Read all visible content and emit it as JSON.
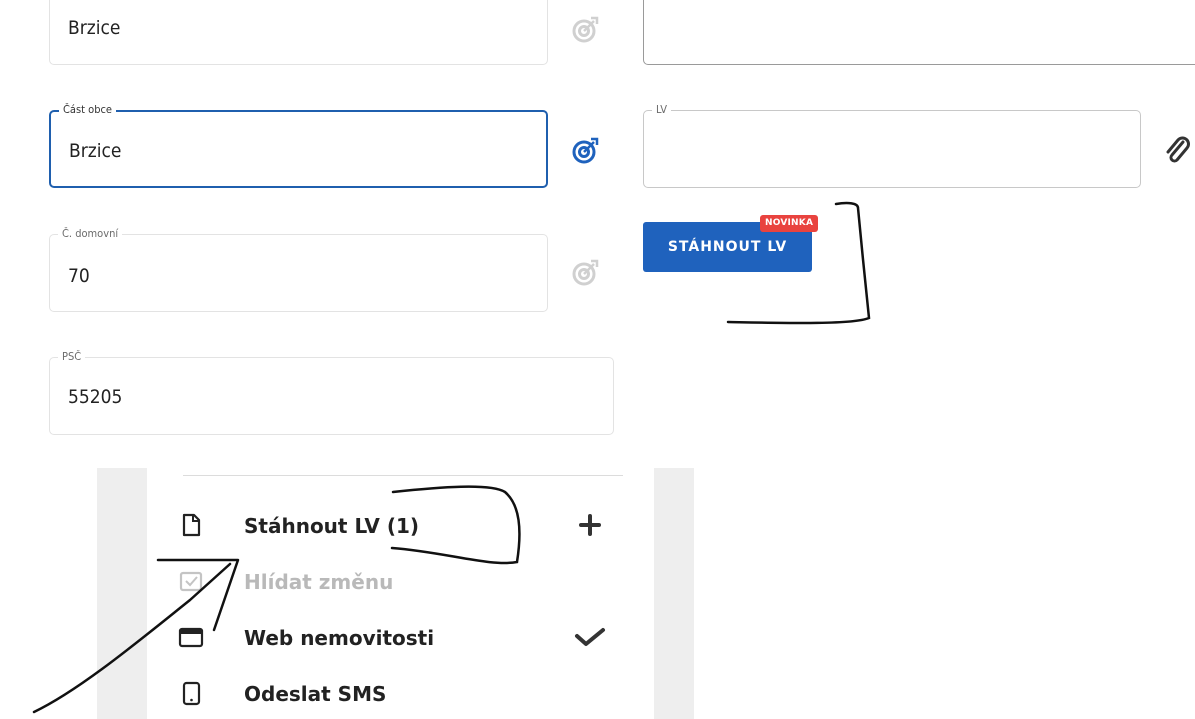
{
  "fields": {
    "obec": {
      "value": "Brzice"
    },
    "cast_obce": {
      "label": "Část obce",
      "value": "Brzice"
    },
    "c_domovni": {
      "label": "Č. domovní",
      "value": "70"
    },
    "psc": {
      "label": "PSČ",
      "value": "55205"
    },
    "lv": {
      "label": "LV",
      "value": ""
    }
  },
  "actions": {
    "download_lv_label": "STÁHNOUT LV",
    "new_badge": "NOVINKA"
  },
  "menu": {
    "items": [
      {
        "label": "Stáhnout LV (1)",
        "icon": "file-icon",
        "right_icon": "plus-icon",
        "disabled": false
      },
      {
        "label": "Hlídat změnu",
        "icon": "checkbox-icon",
        "right_icon": "",
        "disabled": true
      },
      {
        "label": "Web nemovitosti",
        "icon": "browser-window-icon",
        "right_icon": "checkmark-icon",
        "disabled": false
      },
      {
        "label": "Odeslat SMS",
        "icon": "phone-icon",
        "right_icon": "",
        "disabled": false
      }
    ]
  },
  "colors": {
    "primary": "#1f62bd",
    "focus_border": "#1f5fae",
    "badge": "#e9433f",
    "icon_inactive": "#d0d0d0"
  }
}
